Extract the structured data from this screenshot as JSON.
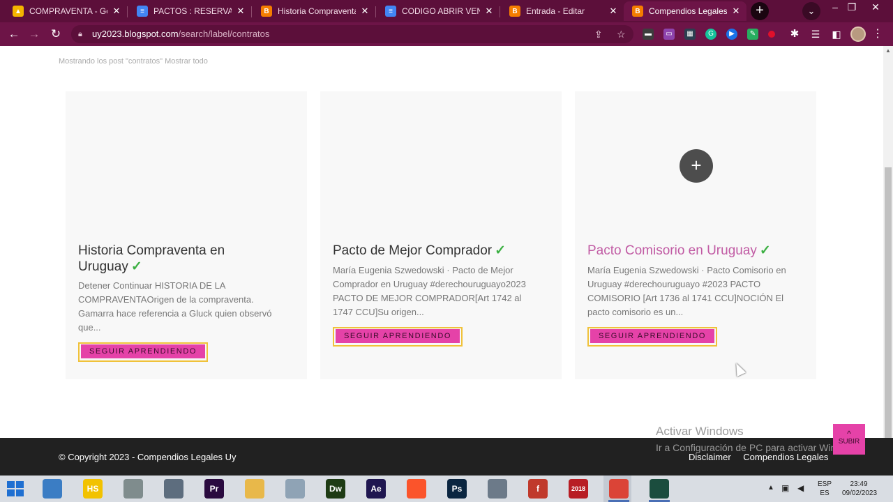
{
  "browser": {
    "tabs": [
      {
        "title": "COMPRAVENTA - Goog",
        "icon": "google-drive-icon",
        "color": "#f4b400",
        "letter": "▲"
      },
      {
        "title": "PACTOS : RESERVA DE I",
        "icon": "google-docs-icon",
        "color": "#4285f4",
        "letter": "≡"
      },
      {
        "title": "Historia Compraventa e",
        "icon": "blogger-icon",
        "color": "#f57d00",
        "letter": "B"
      },
      {
        "title": "CODIGO ABRIR VENTAN",
        "icon": "google-docs-icon",
        "color": "#4285f4",
        "letter": "≡"
      },
      {
        "title": "Entrada - Editar",
        "icon": "blogger-icon",
        "color": "#f57d00",
        "letter": "B"
      },
      {
        "title": "Compendios Legales U",
        "icon": "blogger-icon",
        "color": "#f57d00",
        "letter": "B",
        "active": true
      }
    ],
    "url_host": "uy2023.blogspot.com",
    "url_path": "/search/label/contratos"
  },
  "page": {
    "status_message": "Mostrando los post \"contratos\" Mostrar todo",
    "cards": [
      {
        "title": "Historia Compraventa en Uruguay",
        "checkmark": "✓",
        "excerpt": "Detener Continuar HISTORIA DE LA COMPRAVENTAOrigen de la compraventa. Gamarra hace referencia a Gluck quien observó que...",
        "button": "SEGUIR APRENDIENDO"
      },
      {
        "title": "Pacto de Mejor Comprador",
        "checkmark": "✓",
        "excerpt": "María Eugenia Szwedowski · Pacto de Mejor Comprador en Uruguay #derechouruguayo2023  PACTO DE MEJOR COMPRADOR[Art 1742 al 1747 CCU]Su origen...",
        "button": "SEGUIR APRENDIENDO"
      },
      {
        "title": "Pacto Comisorio en Uruguay",
        "checkmark": "✓",
        "excerpt": "María Eugenia Szwedowski · Pacto Comisorio en Uruguay #derechouruguayo #2023  PACTO COMISORIO [Art 1736 al 1741 CCU]NOCIÓN El pacto comisorio es un...",
        "button": "SEGUIR APRENDIENDO",
        "plus": "+"
      }
    ],
    "activate_windows_title": "Activar Windows",
    "activate_windows_sub": "Ir a Configuración de PC para activar Windows.",
    "scroll_top": "SUBIR"
  },
  "footer": {
    "copyright": "© Copyright 2023 - Compendios Legales Uy",
    "links": [
      "Disclaimer",
      "Compendios Legales"
    ]
  },
  "taskbar": {
    "apps": [
      {
        "name": "control-panel-icon",
        "label": "",
        "color": "#3b7dc4"
      },
      {
        "name": "hs-app-icon",
        "label": "HS",
        "color": "#f2c200"
      },
      {
        "name": "tools-icon",
        "label": "",
        "color": "#7f8c8d"
      },
      {
        "name": "window-app-icon",
        "label": "",
        "color": "#5d6d7e"
      },
      {
        "name": "premiere-icon",
        "label": "Pr",
        "color": "#2a0a3f"
      },
      {
        "name": "file-explorer-icon",
        "label": "",
        "color": "#e8b84a"
      },
      {
        "name": "calculator-icon",
        "label": "",
        "color": "#8fa3b5"
      },
      {
        "name": "dreamweaver-icon",
        "label": "Dw",
        "color": "#1e3b14"
      },
      {
        "name": "after-effects-icon",
        "label": "Ae",
        "color": "#1f1650"
      },
      {
        "name": "brave-icon",
        "label": "",
        "color": "#fb542b"
      },
      {
        "name": "photoshop-icon",
        "label": "Ps",
        "color": "#0a2540"
      },
      {
        "name": "network-tool-icon",
        "label": "",
        "color": "#6c7a89"
      },
      {
        "name": "flash-icon",
        "label": "f",
        "color": "#c0392b"
      },
      {
        "name": "app-2018-icon",
        "label": "2018",
        "color": "#b81d24"
      },
      {
        "name": "chrome-icon",
        "label": "",
        "color": "#db4437"
      },
      {
        "name": "filmora-icon",
        "label": "",
        "color": "#1b4d3e"
      }
    ],
    "lang_top": "ESP",
    "lang_bottom": "ES",
    "time": "23:49",
    "date": "09/02/2023"
  }
}
